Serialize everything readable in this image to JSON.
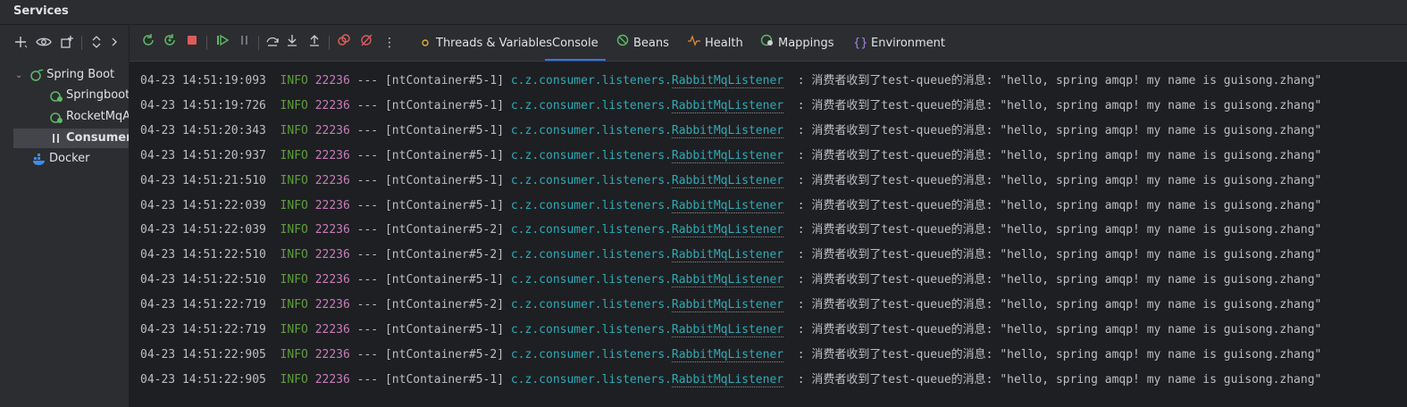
{
  "window": {
    "title": "Services"
  },
  "sidebar": {
    "toolbar": [
      {
        "name": "add-icon",
        "glyph": "+"
      },
      {
        "name": "eye-icon",
        "glyph": "👁"
      },
      {
        "name": "new-window-icon",
        "glyph": "⧉"
      },
      {
        "name": "expand-collapse-icon",
        "glyph": "⌃"
      },
      {
        "name": "chevron-right-icon",
        "glyph": "›"
      }
    ],
    "tree": [
      {
        "label": "Spring Boot",
        "level": 0,
        "caret": "⌄",
        "icon": "spring-boot-icon"
      },
      {
        "label": "SpringbootApplication",
        "level": 1,
        "icon": "spring-app-icon"
      },
      {
        "label": "RocketMqApplication",
        "level": 1,
        "icon": "spring-app-icon"
      },
      {
        "label": "ConsumerApplication",
        "level": 1,
        "icon": "pause-icon",
        "selected": true
      },
      {
        "label": "Docker",
        "level": 0,
        "icon": "docker-icon"
      }
    ]
  },
  "toolbar": {
    "tabs": [
      {
        "label": "Threads & Variables",
        "icon": "threads-icon",
        "glyph": "⚠"
      },
      {
        "label": "Console",
        "active": true
      },
      {
        "label": "Beans",
        "icon": "beans-icon",
        "glyph": "⊘"
      },
      {
        "label": "Health",
        "icon": "health-icon",
        "glyph": "∿"
      },
      {
        "label": "Mappings",
        "icon": "mappings-icon",
        "glyph": "◍"
      },
      {
        "label": "Environment",
        "icon": "environment-icon",
        "glyph": "{}"
      }
    ]
  },
  "console": {
    "logger_prefix": "c.z.consumer.listeners.",
    "logger_class": "RabbitMqListener",
    "separator": "---",
    "message": " : 消费者收到了test-queue的消息: \"hello, spring amqp! my name is guisong.zhang\"",
    "lines": [
      {
        "ts": "04-23 14:51:19:093",
        "level": "INFO",
        "pid": "22236",
        "thread": "[ntContainer#5-1]"
      },
      {
        "ts": "04-23 14:51:19:726",
        "level": "INFO",
        "pid": "22236",
        "thread": "[ntContainer#5-1]"
      },
      {
        "ts": "04-23 14:51:20:343",
        "level": "INFO",
        "pid": "22236",
        "thread": "[ntContainer#5-1]"
      },
      {
        "ts": "04-23 14:51:20:937",
        "level": "INFO",
        "pid": "22236",
        "thread": "[ntContainer#5-1]"
      },
      {
        "ts": "04-23 14:51:21:510",
        "level": "INFO",
        "pid": "22236",
        "thread": "[ntContainer#5-1]"
      },
      {
        "ts": "04-23 14:51:22:039",
        "level": "INFO",
        "pid": "22236",
        "thread": "[ntContainer#5-1]"
      },
      {
        "ts": "04-23 14:51:22:039",
        "level": "INFO",
        "pid": "22236",
        "thread": "[ntContainer#5-2]"
      },
      {
        "ts": "04-23 14:51:22:510",
        "level": "INFO",
        "pid": "22236",
        "thread": "[ntContainer#5-2]"
      },
      {
        "ts": "04-23 14:51:22:510",
        "level": "INFO",
        "pid": "22236",
        "thread": "[ntContainer#5-1]"
      },
      {
        "ts": "04-23 14:51:22:719",
        "level": "INFO",
        "pid": "22236",
        "thread": "[ntContainer#5-2]"
      },
      {
        "ts": "04-23 14:51:22:719",
        "level": "INFO",
        "pid": "22236",
        "thread": "[ntContainer#5-1]"
      },
      {
        "ts": "04-23 14:51:22:905",
        "level": "INFO",
        "pid": "22236",
        "thread": "[ntContainer#5-2]"
      },
      {
        "ts": "04-23 14:51:22:905",
        "level": "INFO",
        "pid": "22236",
        "thread": "[ntContainer#5-1]"
      }
    ]
  },
  "colors": {
    "accent": "#3574f0",
    "info": "#5f9e3a",
    "pid": "#c77dbb",
    "logger": "#2aacb8",
    "stop": "#db5c5c",
    "run": "#5fb865"
  }
}
